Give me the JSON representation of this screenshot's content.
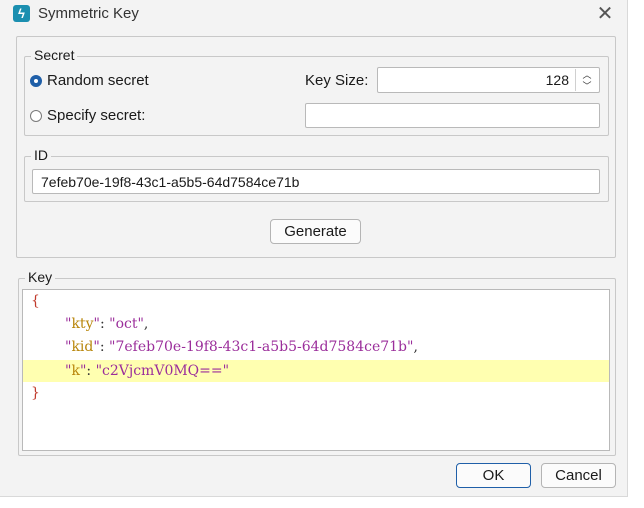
{
  "window": {
    "title": "Symmetric Key",
    "icon": "app-lightning-icon",
    "close_glyph": "✕"
  },
  "secret": {
    "legend": "Secret",
    "random_label": "Random secret",
    "specify_label": "Specify secret:",
    "selected": "random",
    "key_size_label": "Key Size:",
    "key_size_value": "128",
    "specify_value": ""
  },
  "id": {
    "legend": "ID",
    "value": "7efeb70e-19f8-43c1-a5b5-64d7584ce71b"
  },
  "generate_label": "Generate",
  "key": {
    "legend": "Key",
    "open_brace": "{",
    "close_brace": "}",
    "lines": [
      {
        "name": "kty",
        "value": "oct",
        "comma": ","
      },
      {
        "name": "kid",
        "value": "7efeb70e-19f8-43c1-a5b5-64d7584ce71b",
        "comma": ","
      },
      {
        "name": "k",
        "value": "c2VjcmV0MQ==",
        "comma": ""
      }
    ],
    "highlighted_line": 2
  },
  "buttons": {
    "ok": "OK",
    "cancel": "Cancel"
  },
  "colors": {
    "accent": "#1f5fa8",
    "highlight": "#ffffb0",
    "json_key": "#b8860b",
    "json_string": "#9b2e9b",
    "json_brace": "#c0392b"
  }
}
